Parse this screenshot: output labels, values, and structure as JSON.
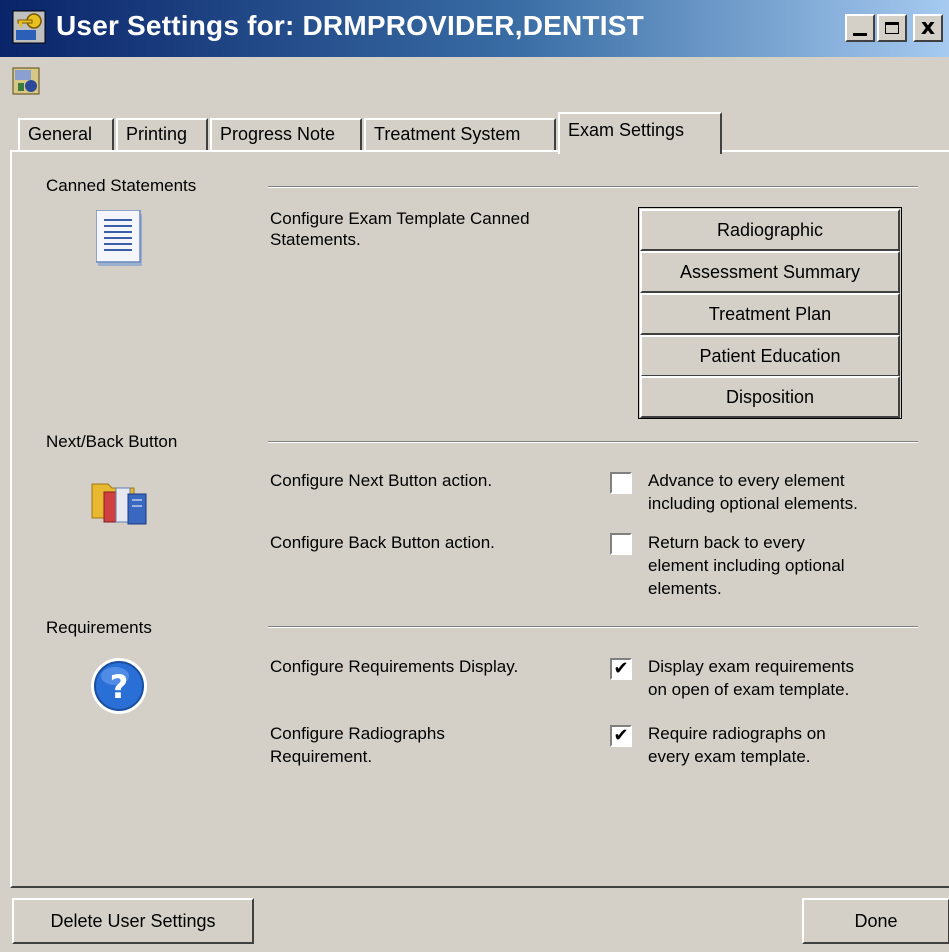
{
  "window": {
    "title": "User Settings for: DRMPROVIDER,DENTIST",
    "controls": {
      "minimize": "_",
      "maximize": "□",
      "close": "x"
    }
  },
  "tabs": [
    {
      "label": "General",
      "active": false
    },
    {
      "label": "Printing",
      "active": false
    },
    {
      "label": "Progress Note",
      "active": false
    },
    {
      "label": "Treatment System",
      "active": false
    },
    {
      "label": "Exam Settings",
      "active": true
    }
  ],
  "canned": {
    "title": "Canned Statements",
    "icon": "document-icon",
    "description_line1": "Configure Exam Template Canned",
    "description_line2": "Statements.",
    "buttons": [
      "Radiographic",
      "Assessment Summary",
      "Treatment Plan",
      "Patient Education",
      "Disposition"
    ]
  },
  "nextback": {
    "title": "Next/Back Button",
    "icon": "folder-files-icon",
    "next_label": "Configure Next Button action.",
    "next_option_line1": "Advance to every element",
    "next_option_line2": "including optional elements.",
    "next_checked": false,
    "back_label": "Configure Back Button action.",
    "back_option_line1": "Return back to every",
    "back_option_line2": "element including optional",
    "back_option_line3": "elements.",
    "back_checked": false
  },
  "requirements": {
    "title": "Requirements",
    "icon": "help-icon",
    "display_label": "Configure Requirements Display.",
    "display_option_line1": "Display exam requirements",
    "display_option_line2": "on open of exam template.",
    "display_checked": true,
    "radio_label_line1": "Configure Radiographs",
    "radio_label_line2": "Requirement.",
    "radio_option_line1": "Require radiographs on",
    "radio_option_line2": "every exam template.",
    "radio_checked": true
  },
  "footer": {
    "delete_label": "Delete User Settings",
    "done_label": "Done"
  },
  "check_glyph": "✔",
  "colors": {
    "titlebar_start": "#0a246a",
    "titlebar_end": "#a6caf0",
    "face": "#d4d0c8",
    "help_blue": "#2a6fd6"
  }
}
